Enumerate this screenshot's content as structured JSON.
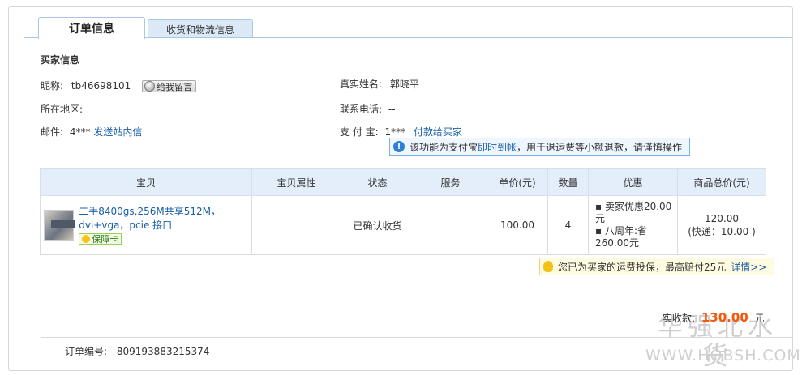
{
  "tabs": [
    {
      "label": "订单信息",
      "active": true
    },
    {
      "label": "收货和物流信息",
      "active": false
    }
  ],
  "buyer": {
    "section_title": "买家信息",
    "nickname_label": "昵称:",
    "nickname_value": "tb46698101",
    "leave_message_label": "给我留言",
    "realname_label": "真实姓名:",
    "realname_value": "郭晓平",
    "region_label": "所在地区:",
    "region_value": "",
    "phone_label": "联系电话:",
    "phone_value": "--",
    "email_label": "邮件:",
    "email_value": "4***",
    "send_message_link": "发送站内信",
    "alipay_label": "支 付 宝:",
    "alipay_value": "1***",
    "pay_buyer_link": "付款给买家"
  },
  "alipay_tip": {
    "prefix": "该功能为支付宝",
    "highlight": "即时到帐",
    "suffix": "，用于退运费等小额退款，请谨慎操作"
  },
  "table": {
    "headers": [
      "宝贝",
      "宝贝属性",
      "状态",
      "服务",
      "单价(元)",
      "数量",
      "优惠",
      "商品总价(元)"
    ],
    "rows": [
      {
        "product_title": "二手8400gs,256M共享512M，dvi+vga，pcie 接口",
        "guarantee_badge": "保障卡",
        "attributes": "",
        "status": "已确认收货",
        "service": "",
        "unit_price": "100.00",
        "quantity": "4",
        "discount_1": "卖家优惠20.00元",
        "discount_2": "八周年:省260.00元",
        "total_price": "120.00",
        "shipping": "(快递：10.00 )"
      }
    ]
  },
  "insurance_note": {
    "text": "您已为买家的运费投保，最高赔付25元",
    "details_link": "详情>>"
  },
  "payment": {
    "label": "实收款:",
    "amount": "130.00",
    "unit": "元"
  },
  "order": {
    "number_label": "订单编号:",
    "number_value": "809193883215374"
  },
  "watermark": {
    "text": "华强北水货",
    "url": "WWW.HQBSH.COM"
  }
}
